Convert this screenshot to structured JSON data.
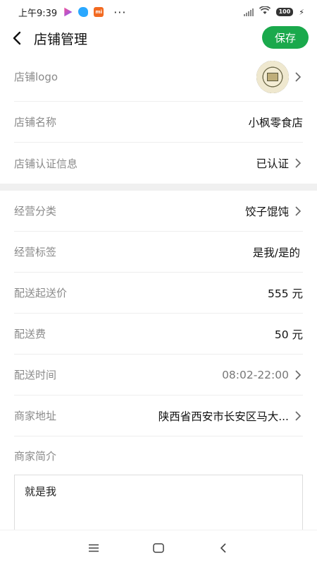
{
  "status_bar": {
    "time": "上午9:39",
    "mi_badge": "mi",
    "more": "···",
    "battery": "100",
    "icons": [
      "play-store-icon",
      "bird-app-icon",
      "mi-app-icon",
      "signal-icon",
      "wifi-icon",
      "battery-icon",
      "charging-icon"
    ]
  },
  "header": {
    "title": "店铺管理",
    "save_label": "保存"
  },
  "rows": {
    "logo": {
      "label": "店铺logo"
    },
    "name": {
      "label": "店铺名称",
      "value": "小枫零食店"
    },
    "cert": {
      "label": "店铺认证信息",
      "value": "已认证"
    },
    "category": {
      "label": "经营分类",
      "value": "饺子馄饨"
    },
    "tags": {
      "label": "经营标签",
      "value": "是我/是的"
    },
    "min_price": {
      "label": "配送起送价",
      "value": "555 元"
    },
    "fee": {
      "label": "配送费",
      "value": "50 元"
    },
    "time": {
      "label": "配送时间",
      "value": "08:02-22:00"
    },
    "address": {
      "label": "商家地址",
      "value": "陕西省西安市长安区马大..."
    },
    "intro": {
      "label": "商家简介",
      "value": "就是我"
    }
  },
  "colors": {
    "accent": "#1aa94c",
    "label": "#8a8a8a",
    "divider": "#eeeeee"
  }
}
